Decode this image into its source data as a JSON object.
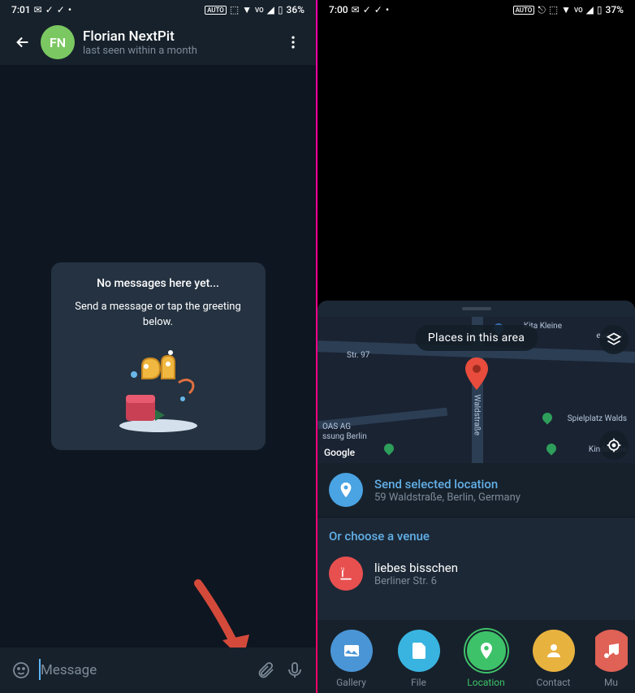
{
  "left": {
    "status": {
      "time": "7:01",
      "battery": "36%"
    },
    "header": {
      "avatar_initials": "FN",
      "name": "Florian NextPit",
      "status": "last seen within a month"
    },
    "empty": {
      "title": "No messages here yet...",
      "subtitle": "Send a message or tap the greeting below."
    },
    "input": {
      "placeholder": "Message"
    }
  },
  "right": {
    "status": {
      "time": "7:00",
      "battery": "37%"
    },
    "map": {
      "pill": "Places in this area",
      "attribution": "Google",
      "labels": {
        "street1": "Str. 97",
        "poi1": "Kita Kleine",
        "poi2": "euer eV",
        "poi3": "OAS AG",
        "poi4": "ssung Berlin",
        "poi5": "Spielplatz Walds",
        "poi6": "Kinderspie",
        "road": "Waldstraße"
      }
    },
    "send": {
      "title": "Send selected location",
      "address": "59 Waldstraße, Berlin, Germany"
    },
    "venue_header": "Or choose a venue",
    "venue": {
      "name": "liebes bisschen",
      "address": "Berliner Str. 6"
    },
    "attach": {
      "gallery": "Gallery",
      "file": "File",
      "location": "Location",
      "contact": "Contact",
      "music": "Mu"
    }
  }
}
